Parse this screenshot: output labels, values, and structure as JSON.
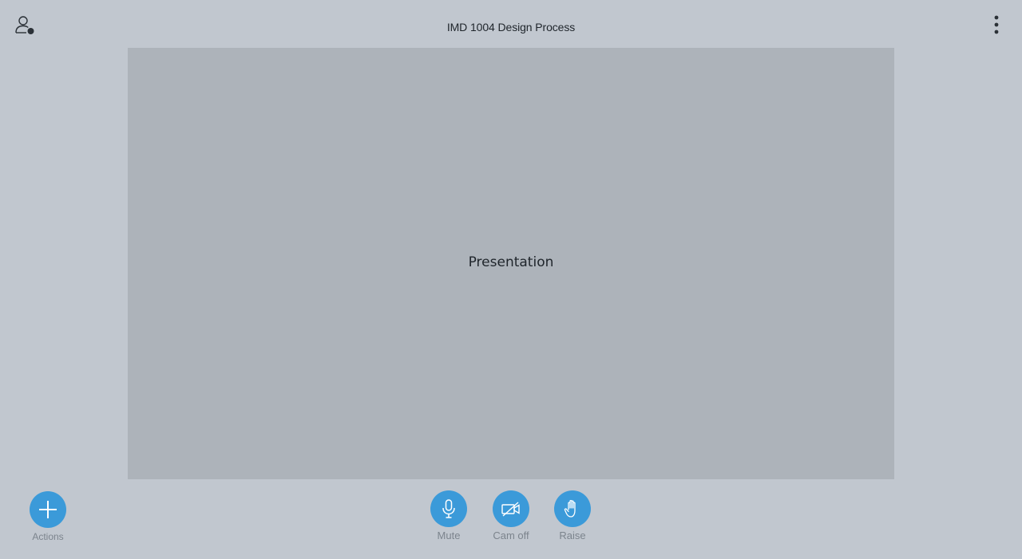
{
  "header": {
    "title": "IMD 1004 Design Process",
    "user_icon": "user-icon",
    "menu_icon": "more-vertical-icon"
  },
  "presentation": {
    "label": "Presentation"
  },
  "controls": {
    "actions": {
      "label": "Actions",
      "icon": "plus-icon"
    },
    "mute": {
      "label": "Mute",
      "icon": "microphone-icon"
    },
    "cam": {
      "label": "Cam off",
      "icon": "camera-off-icon"
    },
    "raise": {
      "label": "Raise",
      "icon": "hand-icon"
    }
  },
  "colors": {
    "background": "#c1c7cf",
    "presentation_bg": "#adb3ba",
    "accent": "#3b9ad9",
    "label": "#7c848d"
  }
}
